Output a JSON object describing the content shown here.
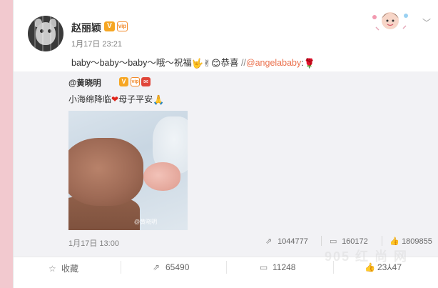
{
  "post": {
    "username": "赵丽颖",
    "timestamp": "1月17日 23:21",
    "text_main": "baby～baby～baby～哦～祝福",
    "text_emoji": "🤟✌😊",
    "text_after": "恭喜",
    "repost_slash": " //",
    "mention": "@angelababy",
    "mention_suffix": ":",
    "rose_emoji": "🌹"
  },
  "badges": {
    "verified": "V",
    "vip": "vip"
  },
  "repost": {
    "author": "@黄晓明",
    "text_before": "小海绵降临",
    "heart": "❤",
    "text_after": "母子平安",
    "pray": "🙏",
    "photo_watermark": "@黄晓明",
    "time": "1月17日 13:00",
    "stats": {
      "reposts": "1044777",
      "comments": "160172",
      "likes": "1809855"
    }
  },
  "actions": {
    "favorite": "收藏",
    "repost": "65490",
    "comment": "11248",
    "like": "23⅄47"
  },
  "site_watermark": "905 红 尚 网",
  "icons": {
    "chevron": "chevron-down-icon",
    "star": "star-icon",
    "share": "share-icon",
    "comment": "comment-icon",
    "like": "thumbs-up-icon"
  },
  "colors": {
    "mention": "#eb7350",
    "background": "#f2c9cf",
    "verified_badge": "#f6a623"
  }
}
